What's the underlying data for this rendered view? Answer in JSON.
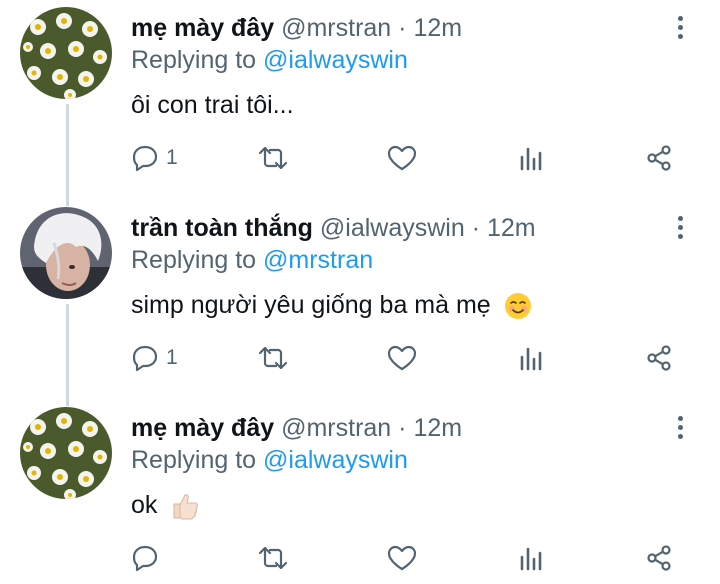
{
  "tweets": [
    {
      "name": "mẹ mày đây",
      "handle": "@mrstran",
      "dot": "·",
      "time": "12m",
      "replying_prefix": "Replying to",
      "replying_to": "@ialwayswin",
      "text": "ôi con trai tôi...",
      "reply_count": "1",
      "avatar": "daisy-flowers",
      "emoji": ""
    },
    {
      "name": "trần toàn thắng",
      "handle": "@ialwayswin",
      "dot": "·",
      "time": "12m",
      "replying_prefix": "Replying to",
      "replying_to": "@mrstran",
      "text": "simp người yêu giống ba mà mẹ",
      "reply_count": "1",
      "avatar": "white-haired-man",
      "emoji": "smiling-face-emoji"
    },
    {
      "name": "mẹ mày đây",
      "handle": "@mrstran",
      "dot": "·",
      "time": "12m",
      "replying_prefix": "Replying to",
      "replying_to": "@ialwayswin",
      "text": "ok",
      "reply_count": "",
      "avatar": "daisy-flowers",
      "emoji": "thumbs-up-emoji"
    }
  ],
  "icons": [
    "reply-icon",
    "retweet-icon",
    "like-icon",
    "analytics-icon",
    "share-icon",
    "more-options-icon"
  ],
  "colors": {
    "text": "#0f1419",
    "secondary": "#536471",
    "link": "#1d9bf0",
    "thread_line": "#cfd9de"
  }
}
